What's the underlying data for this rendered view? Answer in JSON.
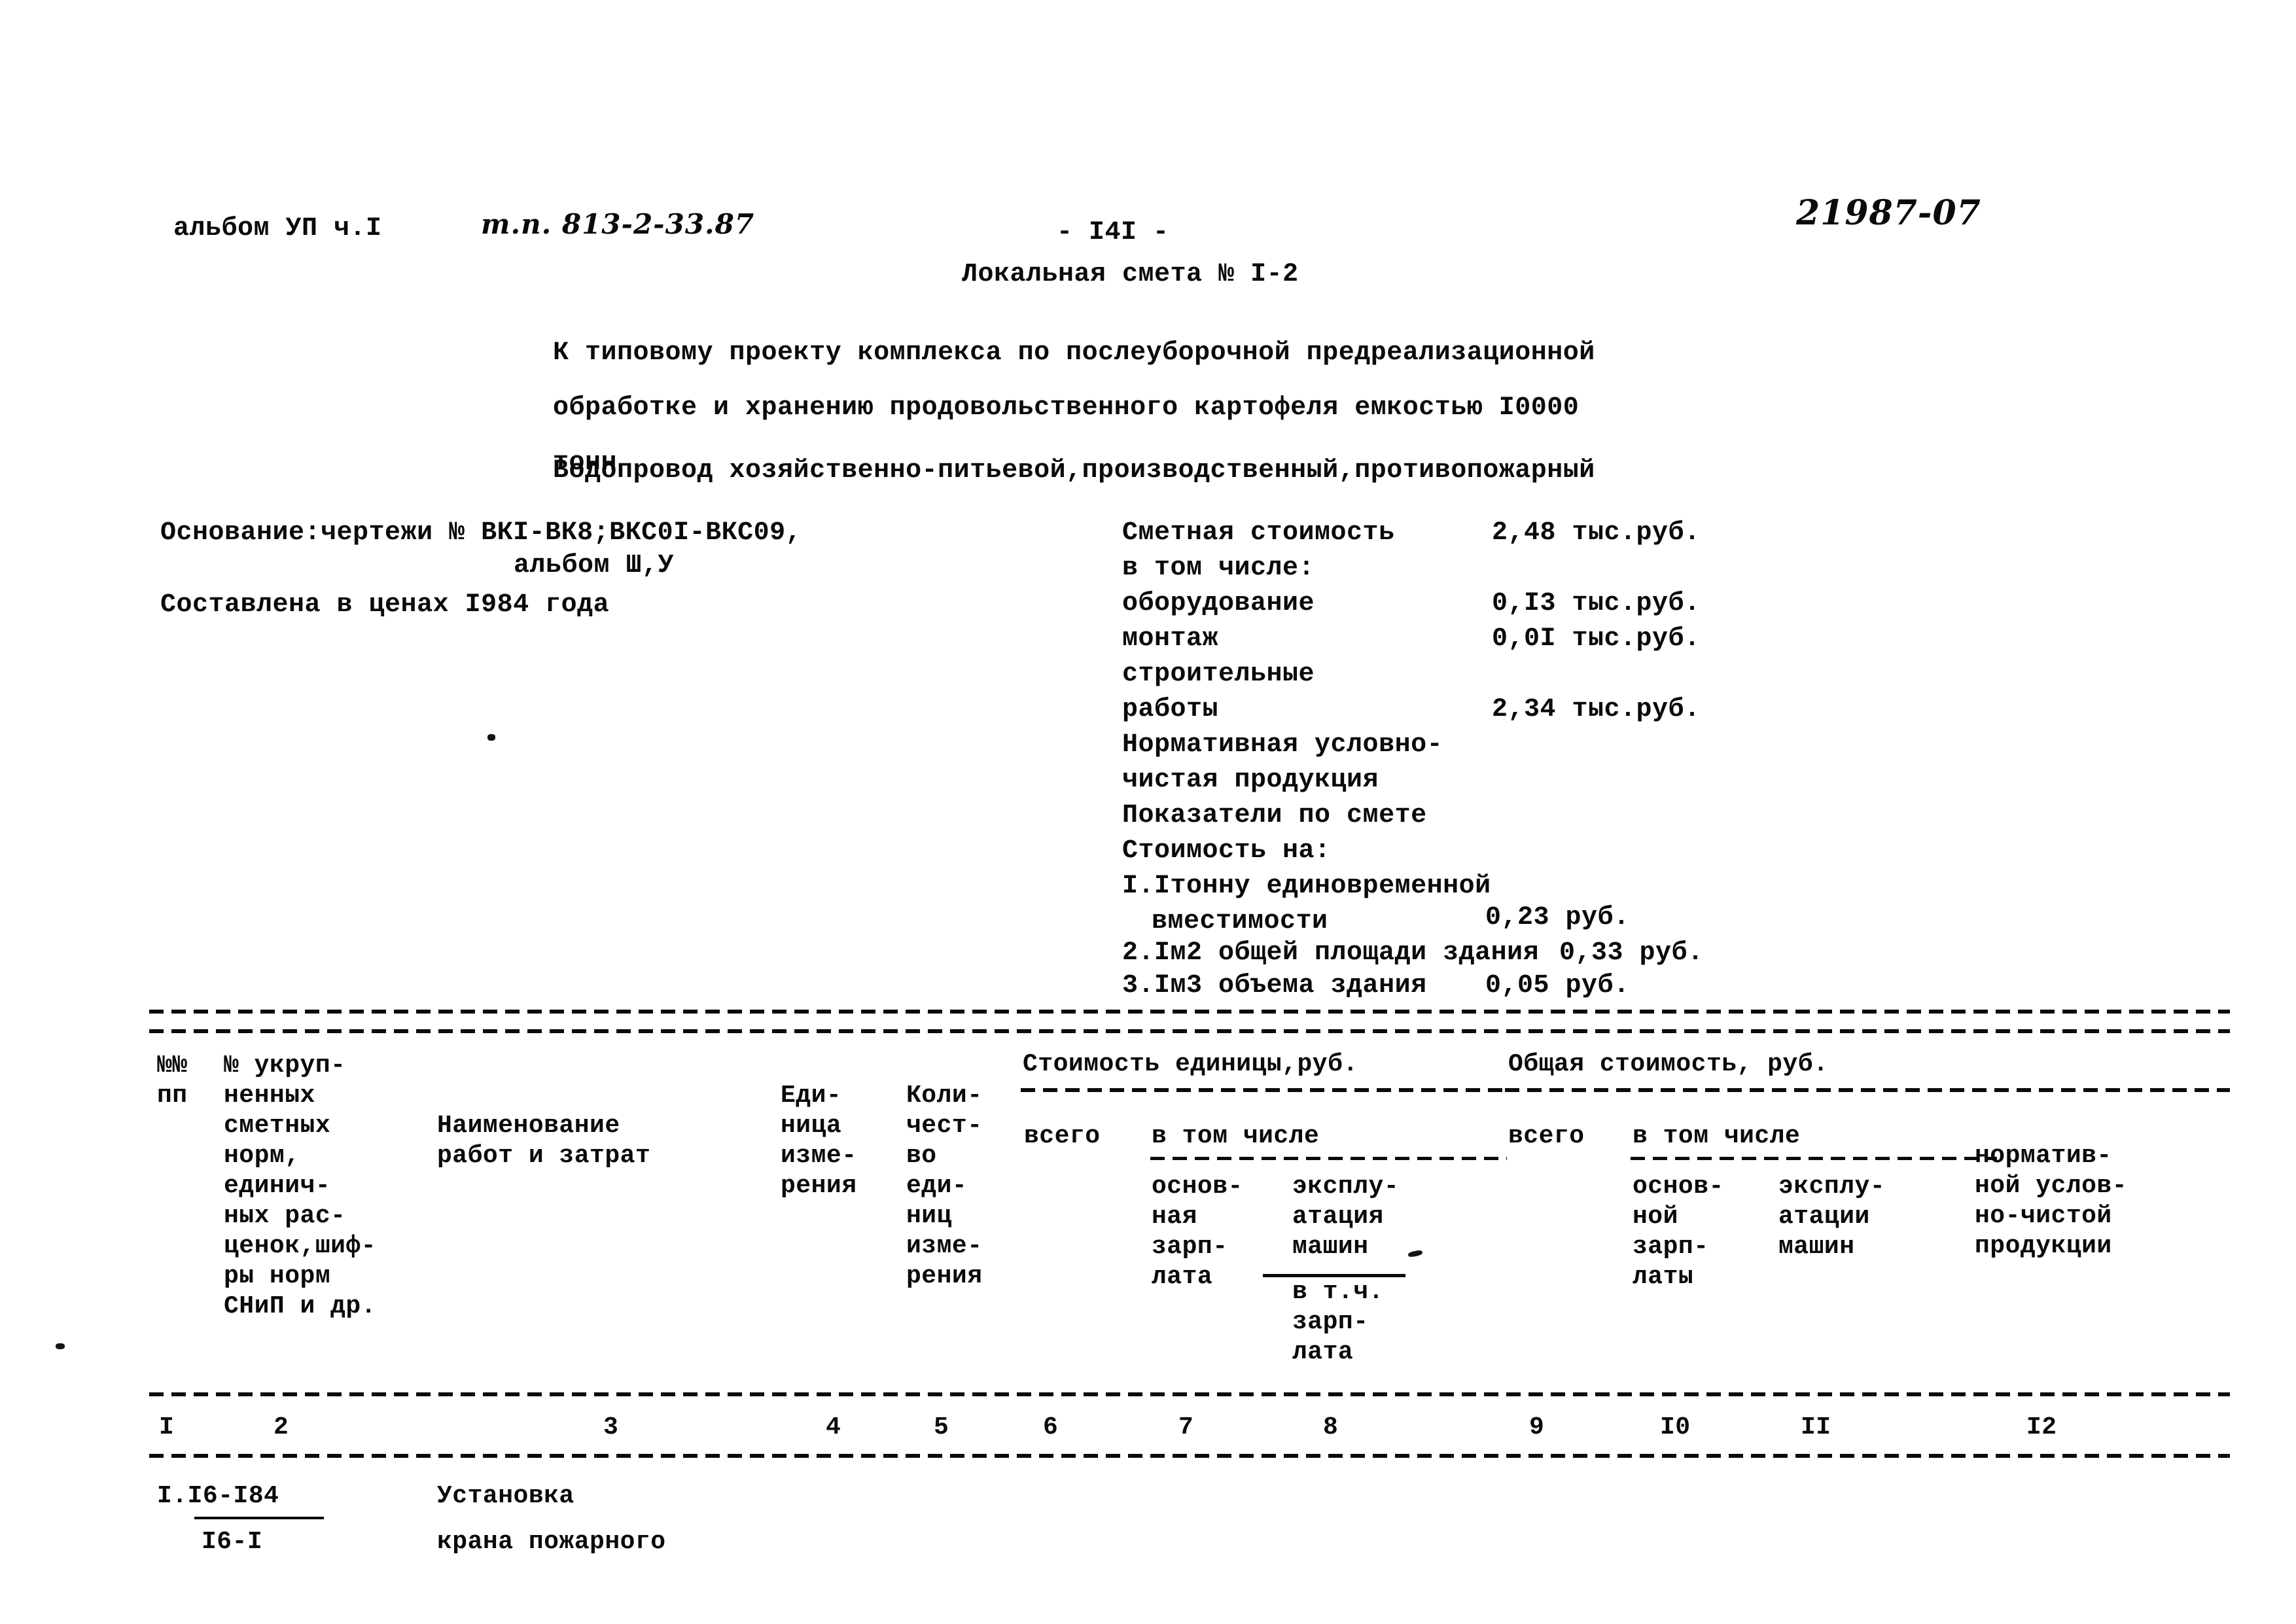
{
  "header": {
    "album": "альбом УП ч.I",
    "project_code": "т.п. 813-2-33.87",
    "page_number": "- I4I -",
    "doc_title": "Локальная смета № I-2",
    "archive_number": "21987-07"
  },
  "intro": {
    "line1": "К типовому проекту комплекса по послеуборочной предреализационной",
    "line2": "обработке и хранению продовольственного картофеля емкостью I0000",
    "line3": "тонн",
    "subject": "Водопровод хозяйственно-питьевой,производственный,противопожарный"
  },
  "basis": {
    "line1": "Основание:чертежи № ВКI-ВК8;ВКС0I-ВКС09,",
    "line2": "альбом Ш,У",
    "line3": "Составлена в ценах I984 года"
  },
  "costs": {
    "total_label": "Сметная стоимость",
    "total_value": "2,48 тыс.руб.",
    "including_label": "в том числе:",
    "items": [
      {
        "label": "оборудование",
        "value": "0,I3 тыс.руб."
      },
      {
        "label": "монтаж",
        "value": "0,0I тыс.руб."
      },
      {
        "label": "строительные",
        "value": ""
      },
      {
        "label": "работы",
        "value": "2,34 тыс.руб."
      }
    ],
    "ncp_line1": "Нормативная условно-",
    "ncp_line2": "чистая продукция",
    "indicators_label": "Показатели по смете",
    "cost_per_label": "Стоимость на:",
    "per_items": [
      {
        "label": "I.Iтонну единовременной",
        "label2": "вместимости",
        "value": "0,23 руб."
      },
      {
        "label": "2.Iм2 общей площади здания",
        "label2": "",
        "value": "0,33 руб."
      },
      {
        "label": "3.Iм3 объема здания",
        "label2": "",
        "value": "0,05 руб."
      }
    ]
  },
  "table": {
    "col1_header": [
      "№№",
      "пп"
    ],
    "col2_header": [
      "№ укруп-",
      "ненных",
      "сметных",
      "норм,",
      "единич-",
      "ных рас-",
      "ценок,шиф-",
      "ры норм",
      "СНиП и др."
    ],
    "col3_header": [
      "Наименование",
      "работ и затрат"
    ],
    "col4_header": [
      "Еди-",
      "ница",
      "изме-",
      "рения"
    ],
    "col5_header": [
      "Коли-",
      "чест-",
      "во",
      "еди-",
      "ниц",
      "изме-",
      "рения"
    ],
    "group_unit_cost": "Стоимость единицы,руб.",
    "group_total_cost": "Общая стоимость, руб.",
    "col6_header": [
      "всего"
    ],
    "unit_in_total": "в том числе",
    "col7_header": [
      "основ-",
      "ная",
      "зарп-",
      "лата"
    ],
    "col8_header": [
      "эксплу-",
      "атация",
      "машин"
    ],
    "col8_sub": [
      "в т.ч.",
      "зарп-",
      "лата"
    ],
    "col9_header": [
      "всего"
    ],
    "total_in_total": "в том числе",
    "col10_header": [
      "основ-",
      "ной",
      "зарп-",
      "латы"
    ],
    "col11_header": [
      "эксплу-",
      "атации",
      "машин"
    ],
    "col12_header": [
      "норматив-",
      "ной услов-",
      "но-чистой",
      "продукции"
    ],
    "column_numbers": [
      "I",
      "2",
      "3",
      "4",
      "5",
      "6",
      "7",
      "8",
      "9",
      "I0",
      "II",
      "I2"
    ],
    "rows": [
      {
        "num_top": "I.I6-I84",
        "num_bottom": "I6-I",
        "name_line1": "Установка",
        "name_line2": "крана пожарного",
        "unit": "",
        "qty": "",
        "unit_total": "",
        "unit_wage": "",
        "unit_machine": "",
        "total_all": "",
        "total_wage": "",
        "total_machine": "",
        "ncp": ""
      }
    ]
  }
}
